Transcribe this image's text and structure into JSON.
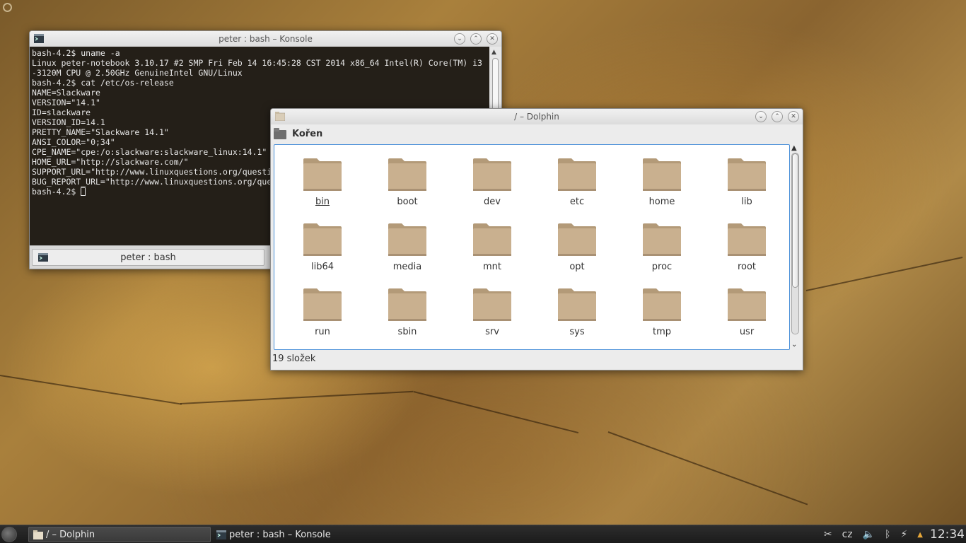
{
  "konsole": {
    "title": "peter : bash – Konsole",
    "lines": [
      "bash-4.2$ uname -a",
      "Linux peter-notebook 3.10.17 #2 SMP Fri Feb 14 16:45:28 CST 2014 x86_64 Intel(R) Core(TM) i3",
      "-3120M CPU @ 2.50GHz GenuineIntel GNU/Linux",
      "bash-4.2$ cat /etc/os-release",
      "NAME=Slackware",
      "VERSION=\"14.1\"",
      "ID=slackware",
      "VERSION_ID=14.1",
      "PRETTY_NAME=\"Slackware 14.1\"",
      "ANSI_COLOR=\"0;34\"",
      "CPE_NAME=\"cpe:/o:slackware:slackware_linux:14.1\"",
      "HOME_URL=\"http://slackware.com/\"",
      "SUPPORT_URL=\"http://www.linuxquestions.org/questi",
      "BUG_REPORT_URL=\"http://www.linuxquestions.org/que"
    ],
    "prompt": "bash-4.2$ ",
    "tab_label": "peter : bash"
  },
  "dolphin": {
    "title": "/ – Dolphin",
    "location": "Kořen",
    "items": [
      "bin",
      "boot",
      "dev",
      "etc",
      "home",
      "lib",
      "lib64",
      "media",
      "mnt",
      "opt",
      "proc",
      "root",
      "run",
      "sbin",
      "srv",
      "sys",
      "tmp",
      "usr"
    ],
    "status": "19 složek"
  },
  "taskbar": {
    "tasks": [
      {
        "label": "/ – Dolphin",
        "icon": "folder-icon"
      },
      {
        "label": "peter : bash – Konsole",
        "icon": "terminal-icon"
      }
    ],
    "keyboard_layout": "cz",
    "clock": "12:34"
  },
  "colors": {
    "folder": "#c9b08f",
    "folder_dark": "#b39a78",
    "selection_border": "#4a90d9",
    "tray_arrow": "#e7a83a"
  }
}
